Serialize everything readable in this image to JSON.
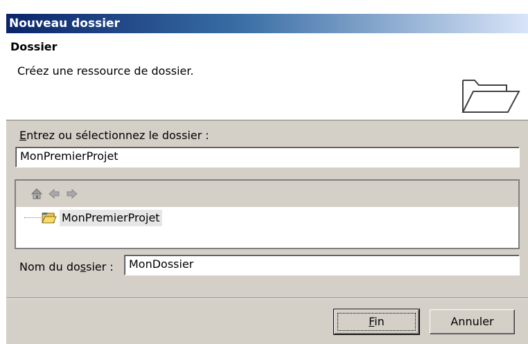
{
  "window": {
    "title": "Nouveau dossier"
  },
  "header": {
    "title": "Dossier",
    "description": "Créez une ressource de dossier.",
    "icon": "open-folder-icon"
  },
  "parent_folder": {
    "label": "Entrez ou sélectionnez le dossier :",
    "mnemonic": "E",
    "value": "MonPremierProjet"
  },
  "tree": {
    "toolbar_icons": [
      "home-icon",
      "back-arrow-icon",
      "forward-arrow-icon"
    ],
    "items": [
      {
        "label": "MonPremierProjet",
        "icon": "project-folder-icon",
        "selected": true
      }
    ]
  },
  "folder_name": {
    "label": "Nom du dossier :",
    "mnemonic": "s",
    "value": "MonDossier"
  },
  "buttons": {
    "finish": "Fin",
    "cancel": "Annuler"
  },
  "colors": {
    "titlebar_start": "#0a246a",
    "titlebar_end": "#d8e4f8",
    "dialog_bg": "#d4d0c8",
    "selection_bg": "#e6e6e6"
  }
}
